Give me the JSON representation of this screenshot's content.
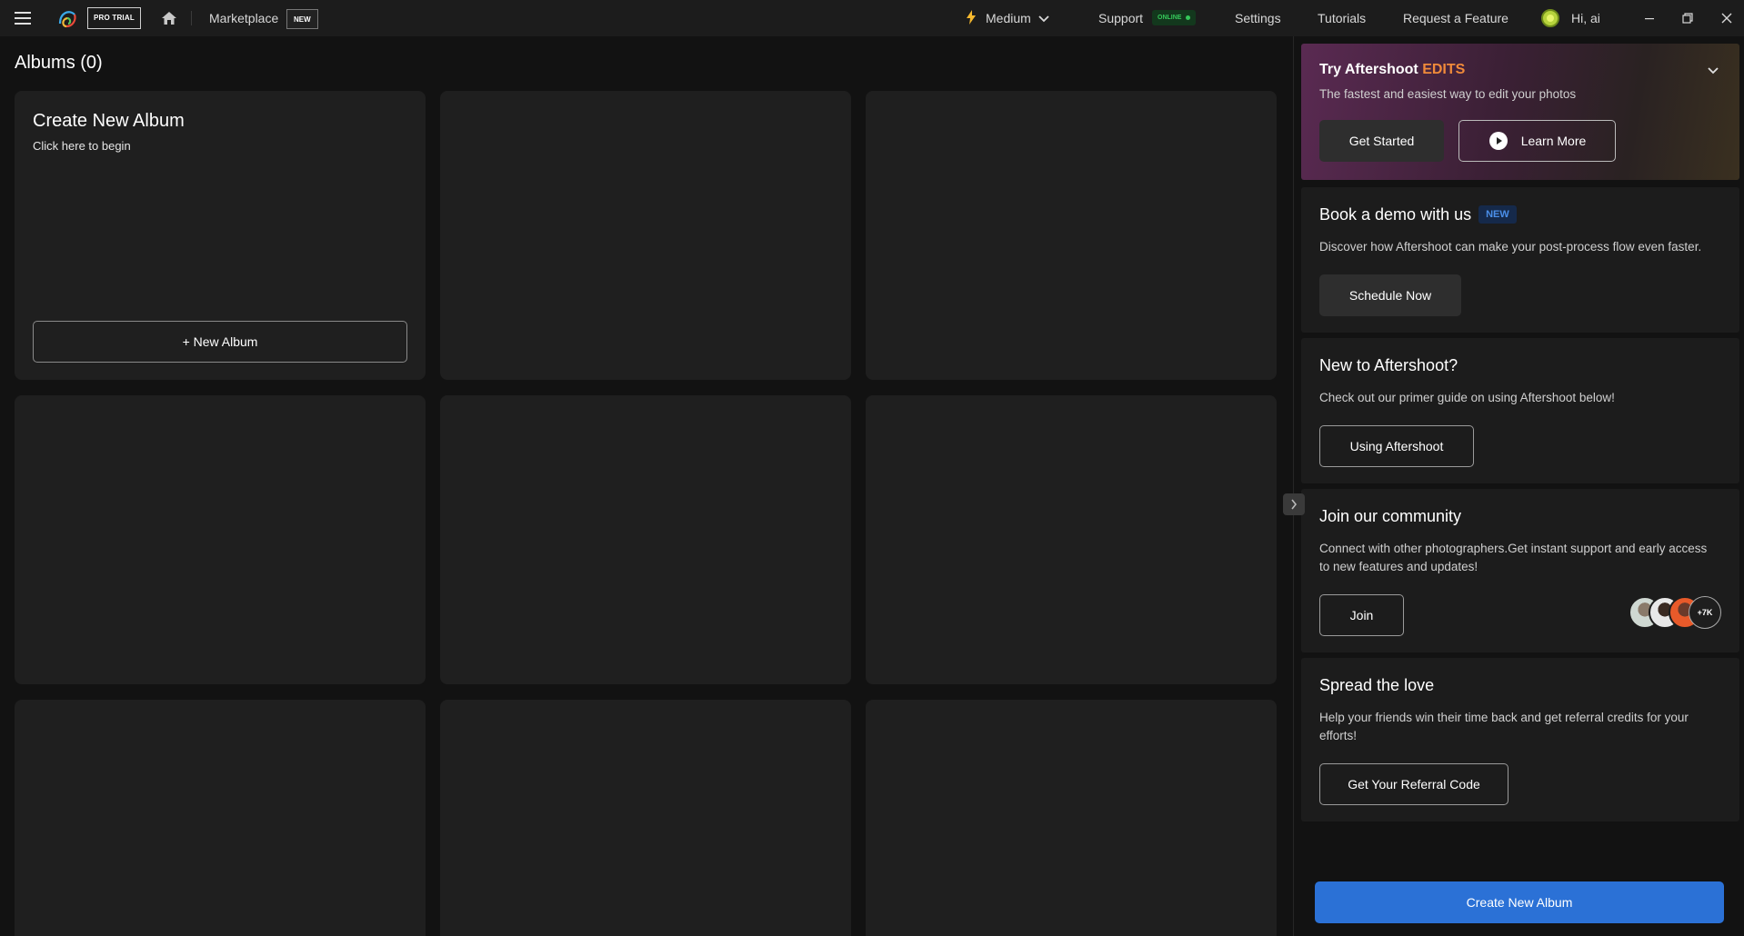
{
  "topbar": {
    "pro_badge": "PRO TRIAL",
    "marketplace": "Marketplace",
    "marketplace_tag": "NEW",
    "performance": "Medium",
    "support": "Support",
    "support_status": "ONLINE",
    "settings": "Settings",
    "tutorials": "Tutorials",
    "request_feature": "Request a Feature",
    "greeting": "Hi, ai"
  },
  "main": {
    "title": "Albums (0)",
    "create_card": {
      "title": "Create New Album",
      "subtitle": "Click here to begin",
      "button": "+ New Album"
    }
  },
  "panel": {
    "edits": {
      "title_prefix": "Try Aftershoot",
      "title_accent": "EDITS",
      "subtitle": "The fastest and easiest way to edit your photos",
      "primary_button": "Get Started",
      "secondary_button": "Learn More"
    },
    "demo": {
      "title": "Book a demo with us",
      "badge": "NEW",
      "text": "Discover how Aftershoot can make your post-process flow even faster.",
      "button": "Schedule Now"
    },
    "primer": {
      "title": "New to Aftershoot?",
      "text": "Check out our primer guide on using Aftershoot below!",
      "button": "Using Aftershoot"
    },
    "community": {
      "title": "Join our community",
      "text": "Connect with other photographers.Get instant support and early access to new features and updates!",
      "button": "Join",
      "member_count": "+7K"
    },
    "referral": {
      "title": "Spread the love",
      "text": "Help your friends win their time back and get referral credits for your efforts!",
      "button": "Get Your Referral Code"
    },
    "create_button": "Create New Album"
  },
  "colors": {
    "accent_blue": "#2b71d6",
    "edits_orange": "#f08a3a",
    "online_green": "#35c85a"
  }
}
